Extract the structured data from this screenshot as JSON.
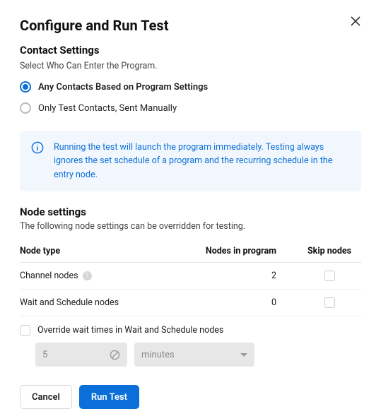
{
  "dialog": {
    "title": "Configure and Run Test"
  },
  "contact": {
    "heading": "Contact Settings",
    "instruction": "Select Who Can Enter the Program.",
    "options": [
      {
        "label": "Any Contacts Based on Program Settings",
        "selected": true
      },
      {
        "label": "Only Test Contacts, Sent Manually",
        "selected": false
      }
    ]
  },
  "info": {
    "text": "Running the test will launch the program immediately. Testing always ignores the set schedule of a program and the recurring schedule in the entry node."
  },
  "nodes": {
    "heading": "Node settings",
    "instruction": "The following node settings can be overridden for testing.",
    "columns": {
      "type": "Node type",
      "count": "Nodes in program",
      "skip": "Skip nodes"
    },
    "rows": [
      {
        "type": "Channel nodes",
        "count": "2",
        "help": true
      },
      {
        "type": "Wait and Schedule nodes",
        "count": "0",
        "help": false
      }
    ],
    "override": {
      "label": "Override wait times in Wait and Schedule nodes",
      "value": "5",
      "unit": "minutes"
    }
  },
  "footer": {
    "cancel": "Cancel",
    "run": "Run Test"
  }
}
